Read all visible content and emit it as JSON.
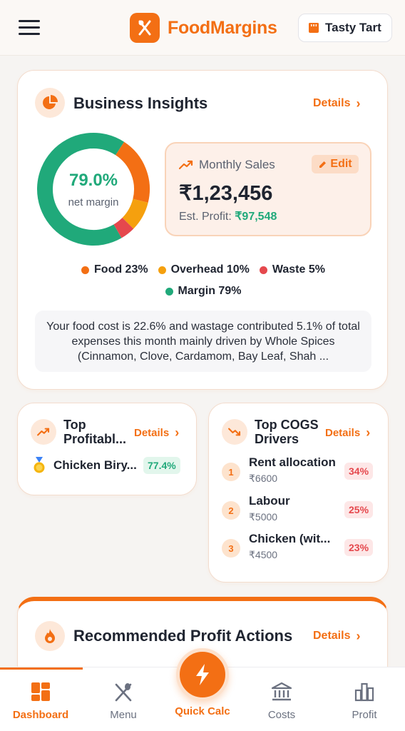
{
  "header": {
    "app_name": "FoodMargins",
    "store_name": "Tasty Tart",
    "brand_color": "#f36f14"
  },
  "insights": {
    "title": "Business Insights",
    "details_label": "Details",
    "net_margin_value": "79.0%",
    "net_margin_label": "net margin",
    "monthly_sales_label": "Monthly Sales",
    "edit_label": "Edit",
    "sales_amount": "₹1,23,456",
    "profit_prefix": "Est. Profit: ",
    "profit_amount": "₹97,548",
    "legend": [
      {
        "label": "Food 23%",
        "color": "#f36f14"
      },
      {
        "label": "Overhead 10%",
        "color": "#f5a00e"
      },
      {
        "label": "Waste 5%",
        "color": "#e5484d"
      },
      {
        "label": "Margin 79%",
        "color": "#20a97a"
      }
    ],
    "summary": "Your food cost is 22.6% and wastage contributed 5.1% of total expenses this month mainly driven by Whole Spices (Cinnamon, Clove, Cardamom, Bay Leaf, Shah ..."
  },
  "chart_data": {
    "type": "pie",
    "categories": [
      "Margin",
      "Food",
      "Overhead",
      "Waste"
    ],
    "values": [
      79,
      23,
      10,
      5
    ],
    "colors": [
      "#20a97a",
      "#f36f14",
      "#f5a00e",
      "#e5484d"
    ],
    "center_text": "79.0%"
  },
  "top_profitable": {
    "title_line1": "Top",
    "title_line2": "Profitabl...",
    "details_label": "Details",
    "item_name": "Chicken Biry...",
    "item_pct": "77.4%"
  },
  "top_cogs": {
    "title_line1": "Top COGS",
    "title_line2": "Drivers",
    "details_label": "Details",
    "items": [
      {
        "rank": "1",
        "name": "Rent allocation",
        "amount": "₹6600",
        "pct": "34%"
      },
      {
        "rank": "2",
        "name": "Labour",
        "amount": "₹5000",
        "pct": "25%"
      },
      {
        "rank": "3",
        "name": "Chicken (wit...",
        "amount": "₹4500",
        "pct": "23%"
      }
    ]
  },
  "actions": {
    "title": "Recommended Profit Actions",
    "details_label": "Details"
  },
  "nav": {
    "dashboard": "Dashboard",
    "menu": "Menu",
    "quick_calc": "Quick Calc",
    "costs": "Costs",
    "profit": "Profit"
  }
}
